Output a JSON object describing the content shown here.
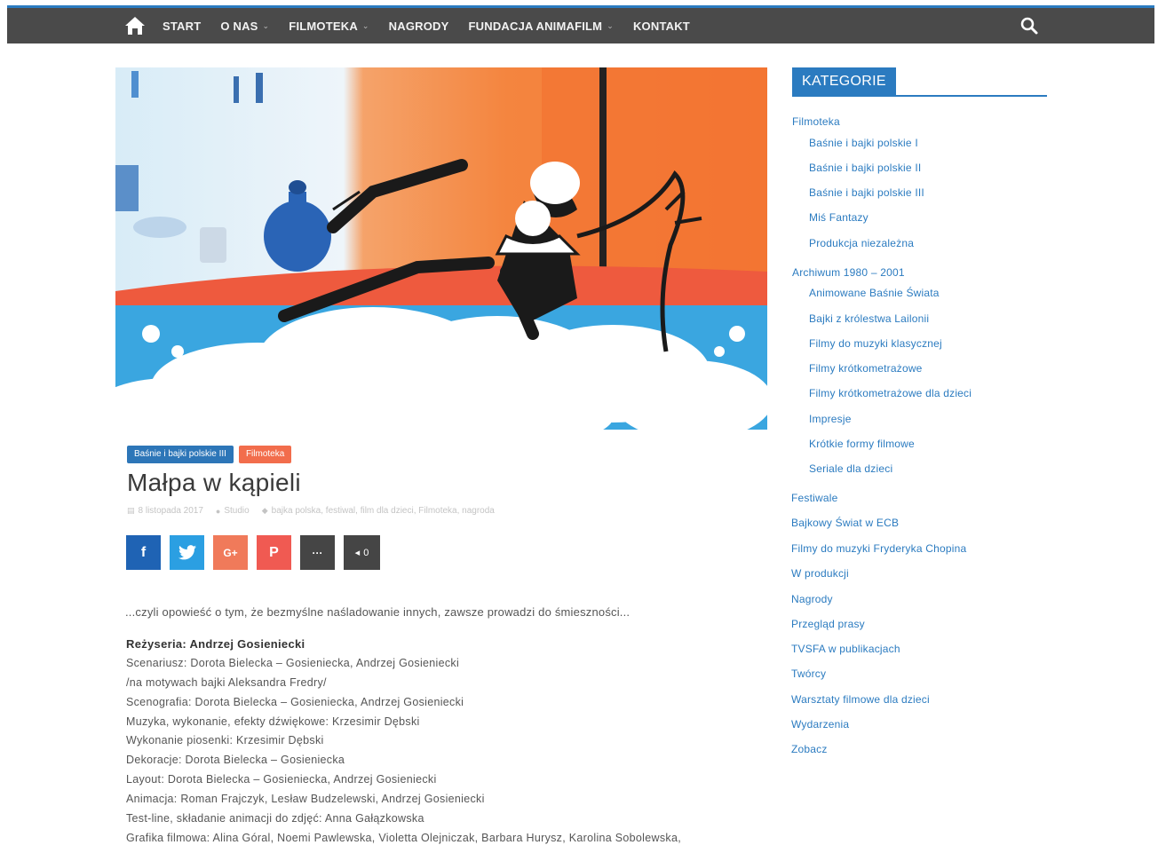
{
  "nav": {
    "items": [
      {
        "label": "START",
        "has_dropdown": false
      },
      {
        "label": "O NAS",
        "has_dropdown": true
      },
      {
        "label": "FILMOTEKA",
        "has_dropdown": true
      },
      {
        "label": "NAGRODY",
        "has_dropdown": false
      },
      {
        "label": "FUNDACJA ANIMAFILM",
        "has_dropdown": true
      },
      {
        "label": "KONTAKT",
        "has_dropdown": false
      }
    ],
    "home_icon": "home-icon",
    "search_icon": "search-icon",
    "bar_color": "#4a4a4a",
    "accent_color": "#2b7bc0"
  },
  "post": {
    "badges": [
      {
        "label": "Baśnie i bajki polskie III",
        "color": "#2d76b8"
      },
      {
        "label": "Filmoteka",
        "color": "#f26d4c"
      }
    ],
    "title": "Małpa w kąpieli",
    "meta": {
      "date": "8 listopada 2017",
      "author": "Studio",
      "tags": "bajka polska, festiwal, film dla dzieci, Filmoteka, nagroda"
    },
    "share": {
      "facebook": "f",
      "twitter": "twitter-bird-icon",
      "googleplus": "G+",
      "pinterest": "P",
      "more": "···",
      "count": "0"
    },
    "intro": "...czyli opowieść o tym, że bezmyślne naśladowanie innych, zawsze prowadzi do śmieszności...",
    "credits": [
      "Reżyseria: Andrzej Gosieniecki",
      "Scenariusz: Dorota Bielecka – Gosieniecka, Andrzej Gosieniecki",
      "/na motywach bajki Aleksandra Fredry/",
      "Scenografia: Dorota Bielecka – Gosieniecka, Andrzej Gosieniecki",
      "Muzyka, wykonanie, efekty dźwiękowe: Krzesimir Dębski",
      "Wykonanie piosenki: Krzesimir Dębski",
      "Dekoracje: Dorota Bielecka – Gosieniecka",
      "Layout: Dorota Bielecka – Gosieniecka, Andrzej Gosieniecki",
      "Animacja: Roman Frajczyk, Lesław Budzelewski, Andrzej Gosieniecki",
      "Test-line, składanie animacji do zdjęć: Anna Gałązkowska",
      "Grafika filmowa: Alina Góral, Noemi Pawlewska, Violetta Olejniczak, Barbara Hurysz, Karolina Sobolewska,"
    ]
  },
  "sidebar": {
    "title": "KATEGORIE",
    "categories": [
      {
        "label": "Filmoteka",
        "level": 0
      },
      {
        "label": "Baśnie i bajki polskie I",
        "level": 1
      },
      {
        "label": "Baśnie i bajki polskie II",
        "level": 1
      },
      {
        "label": "Baśnie i bajki polskie III",
        "level": 1
      },
      {
        "label": "Miś Fantazy",
        "level": 1
      },
      {
        "label": "Produkcja niezależna",
        "level": 1
      },
      {
        "label": "Archiwum 1980 – 2001",
        "level": 0
      },
      {
        "label": "Animowane Baśnie Świata",
        "level": 1
      },
      {
        "label": "Bajki z królestwa Lailonii",
        "level": 1
      },
      {
        "label": "Filmy do muzyki klasycznej",
        "level": 1
      },
      {
        "label": "Filmy krótkometrażowe",
        "level": 1
      },
      {
        "label": "Filmy krótkometrażowe dla dzieci",
        "level": 1
      },
      {
        "label": "Impresje",
        "level": 1
      },
      {
        "label": "Krótkie formy filmowe",
        "level": 1
      },
      {
        "label": "Seriale dla dzieci",
        "level": 1
      },
      {
        "label": "Festiwale",
        "level": 0
      },
      {
        "label": "Bajkowy Świat w ECB",
        "level": 0
      },
      {
        "label": "Filmy do muzyki Fryderyka Chopina",
        "level": 0
      },
      {
        "label": "W produkcji",
        "level": 0
      },
      {
        "label": "Nagrody",
        "level": 0
      },
      {
        "label": "Przegląd prasy",
        "level": 0
      },
      {
        "label": "TVSFA w publikacjach",
        "level": 0
      },
      {
        "label": "Twórcy",
        "level": 0
      },
      {
        "label": "Warsztaty filmowe dla dzieci",
        "level": 0
      },
      {
        "label": "Wydarzenia",
        "level": 0
      },
      {
        "label": "Zobacz",
        "level": 0
      }
    ]
  }
}
